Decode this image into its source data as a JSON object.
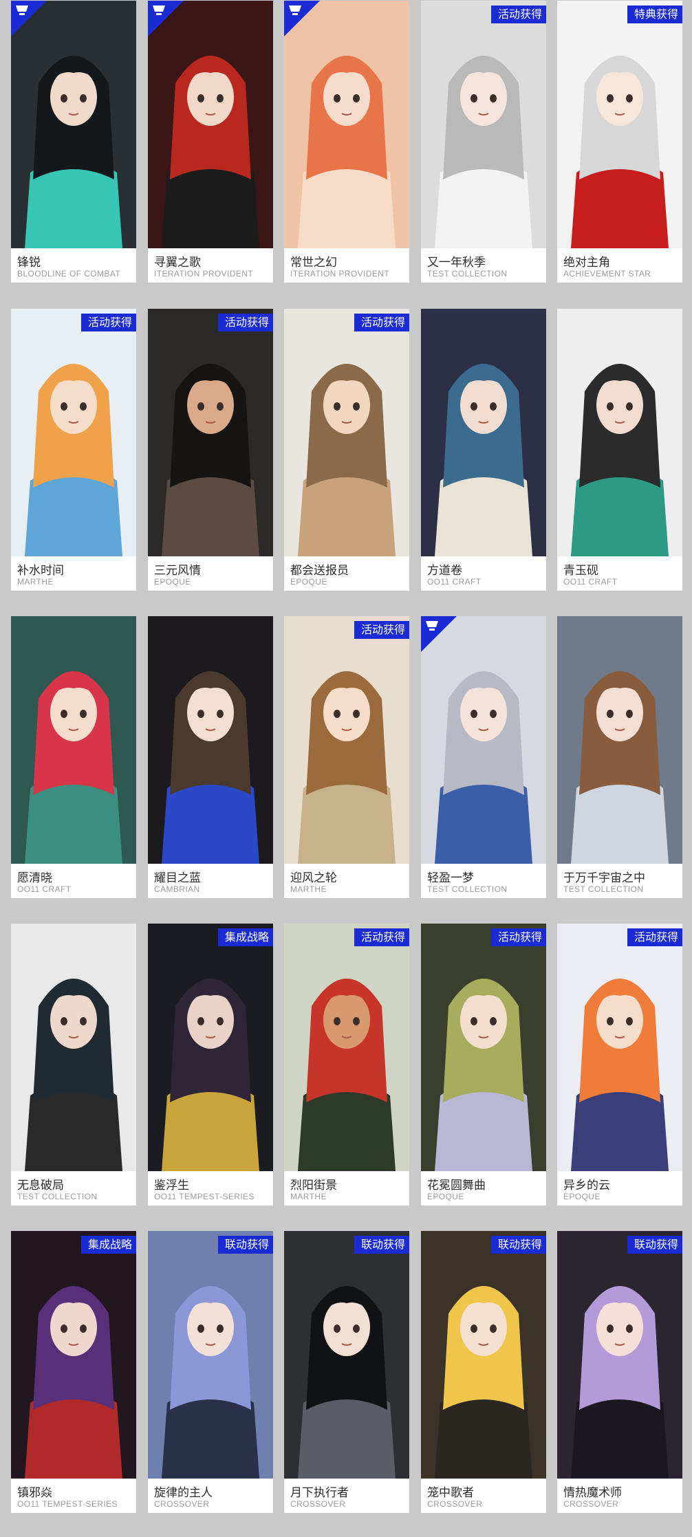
{
  "cards": [
    {
      "name": "锋锐",
      "series": "BLOODLINE OF COMBAT",
      "tag": "",
      "corner": true,
      "bg": "#2a2f33",
      "hair": "#15181a",
      "accent": "#38c6b4",
      "skin": "#f1d9cc"
    },
    {
      "name": "寻翼之歌",
      "series": "ITERATION PROVIDENT",
      "tag": "",
      "corner": true,
      "bg": "#3a1616",
      "hair": "#b8281f",
      "accent": "#1c1c1c",
      "skin": "#f2d8c8"
    },
    {
      "name": "常世之幻",
      "series": "ITERATION PROVIDENT",
      "tag": "",
      "corner": true,
      "bg": "#f0c2a6",
      "hair": "#e8744a",
      "accent": "#f6dcc6",
      "skin": "#f6dccd"
    },
    {
      "name": "又一年秋季",
      "series": "TEST COLLECTION",
      "tag": "活动获得",
      "corner": false,
      "bg": "#dcdcdc",
      "hair": "#b9b9b9",
      "accent": "#f2f2f2",
      "skin": "#f4e4dc"
    },
    {
      "name": "绝对主角",
      "series": "ACHIEVEMENT STAR",
      "tag": "特典获得",
      "corner": false,
      "bg": "#f2f2f2",
      "hair": "#d7d7d7",
      "accent": "#c81d1d",
      "skin": "#f7e6da"
    },
    {
      "name": "补水时间",
      "series": "MARTHE",
      "tag": "活动获得",
      "corner": false,
      "bg": "#e7eef4",
      "hair": "#f0a24a",
      "accent": "#5fa6d8",
      "skin": "#f6ddca"
    },
    {
      "name": "三元风情",
      "series": "EPOQUE",
      "tag": "活动获得",
      "corner": false,
      "bg": "#2c2a29",
      "hair": "#161514",
      "accent": "#5b4b42",
      "skin": "#d9a98a"
    },
    {
      "name": "都会送报员",
      "series": "EPOQUE",
      "tag": "活动获得",
      "corner": false,
      "bg": "#e9e6e0",
      "hair": "#8a6a4a",
      "accent": "#c8a27a",
      "skin": "#f2d6bf"
    },
    {
      "name": "方道卷",
      "series": "OO11 CRAFT",
      "tag": "",
      "corner": false,
      "bg": "#2c2f45",
      "hair": "#3b6c8f",
      "accent": "#e8e3d4",
      "skin": "#f1dccf"
    },
    {
      "name": "青玉砚",
      "series": "OO11 CRAFT",
      "tag": "",
      "corner": false,
      "bg": "#eeeeee",
      "hair": "#2b2b2b",
      "accent": "#2d9a86",
      "skin": "#f1dccf"
    },
    {
      "name": "愿清晓",
      "series": "OO11 CRAFT",
      "tag": "",
      "corner": false,
      "bg": "#2f5850",
      "hair": "#d8344a",
      "accent": "#3b8f82",
      "skin": "#f4dccd"
    },
    {
      "name": "耀目之蓝",
      "series": "CAMBRIAN",
      "tag": "",
      "corner": false,
      "bg": "#1c1a1d",
      "hair": "#4a3a2e",
      "accent": "#2b48c9",
      "skin": "#f3dfd2"
    },
    {
      "name": "迎风之轮",
      "series": "MARTHE",
      "tag": "活动获得",
      "corner": false,
      "bg": "#e8ded0",
      "hair": "#9b6b3e",
      "accent": "#c8b28a",
      "skin": "#f5ddca"
    },
    {
      "name": "轻盈一梦",
      "series": "TEST COLLECTION",
      "tag": "",
      "corner": true,
      "bg": "#d7d9e0",
      "hair": "#b7b9c4",
      "accent": "#3a5fa8",
      "skin": "#f3e3da"
    },
    {
      "name": "于万千宇宙之中",
      "series": "TEST COLLECTION",
      "tag": "",
      "corner": false,
      "bg": "#6f7a8a",
      "hair": "#8a5c3e",
      "accent": "#cfd6e0",
      "skin": "#f2ded2"
    },
    {
      "name": "无息破局",
      "series": "TEST COLLECTION",
      "tag": "",
      "corner": false,
      "bg": "#e9e9e9",
      "hair": "#1f2a33",
      "accent": "#2a2a2a",
      "skin": "#eed8cb"
    },
    {
      "name": "鉴浮生",
      "series": "OO11 TEMPEST-SERIES",
      "tag": "集成战略",
      "corner": false,
      "bg": "#1b1b22",
      "hair": "#2e2638",
      "accent": "#c9a43a",
      "skin": "#e9d3c8"
    },
    {
      "name": "烈阳街景",
      "series": "MARTHE",
      "tag": "活动获得",
      "corner": false,
      "bg": "#cfd4c4",
      "hair": "#c7342a",
      "accent": "#2d3a2a",
      "skin": "#d9996f"
    },
    {
      "name": "花冕圆舞曲",
      "series": "EPOQUE",
      "tag": "活动获得",
      "corner": false,
      "bg": "#3a3e2c",
      "hair": "#a7ad5c",
      "accent": "#b9b7d6",
      "skin": "#f2ddcf"
    },
    {
      "name": "异乡的云",
      "series": "EPOQUE",
      "tag": "活动获得",
      "corner": false,
      "bg": "#ecedf2",
      "hair": "#f07c3a",
      "accent": "#3a3f7a",
      "skin": "#f6dccb"
    },
    {
      "name": "镇邪焱",
      "series": "OO11 TEMPEST-SERIES",
      "tag": "集成战略",
      "corner": false,
      "bg": "#22161f",
      "hair": "#5a2f7a",
      "accent": "#b12a2a",
      "skin": "#f0d6cc"
    },
    {
      "name": "旋律的主人",
      "series": "CROSSOVER",
      "tag": "联动获得",
      "corner": false,
      "bg": "#6f7fae",
      "hair": "#8b97d6",
      "accent": "#2a2f4a",
      "skin": "#f3e0d6"
    },
    {
      "name": "月下执行者",
      "series": "CROSSOVER",
      "tag": "联动获得",
      "corner": false,
      "bg": "#2e2f33",
      "hair": "#111214",
      "accent": "#5a5d66",
      "skin": "#f2dfd4"
    },
    {
      "name": "笼中歌者",
      "series": "CROSSOVER",
      "tag": "联动获得",
      "corner": false,
      "bg": "#3b3328",
      "hair": "#f0c64a",
      "accent": "#2a2622",
      "skin": "#f4e0d0"
    },
    {
      "name": "情热魔术师",
      "series": "CROSSOVER",
      "tag": "联动获得",
      "corner": false,
      "bg": "#2b2530",
      "hair": "#b49ad8",
      "accent": "#1b1720",
      "skin": "#f4e0d6"
    }
  ]
}
